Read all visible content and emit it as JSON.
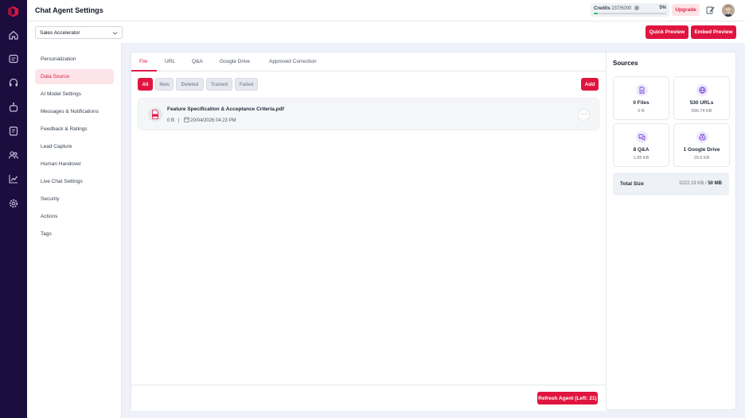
{
  "header": {
    "title": "Chat Agent Settings",
    "credits_label": "Credits",
    "credits_value": "237/5000",
    "credits_percent": "5%",
    "credits_fraction": 0.05,
    "upgrade_label": "Upgrade"
  },
  "toolbar": {
    "agent_select_value": "Sales Accelerator",
    "quick_preview_label": "Quick Preview",
    "embed_preview_label": "Embed Preview"
  },
  "nav": {
    "items": [
      {
        "label": "Personalization"
      },
      {
        "label": "Data Source"
      },
      {
        "label": "AI Model Settings"
      },
      {
        "label": "Messages & Notifications"
      },
      {
        "label": "Feedback & Ratings"
      },
      {
        "label": "Lead Capture"
      },
      {
        "label": "Human Handover"
      },
      {
        "label": "Live Chat Settings"
      },
      {
        "label": "Security"
      },
      {
        "label": "Actions"
      },
      {
        "label": "Tags"
      }
    ],
    "active_index": 1
  },
  "tabs": [
    {
      "label": "File"
    },
    {
      "label": "URL"
    },
    {
      "label": "Q&A"
    },
    {
      "label": "Google Drive"
    },
    {
      "label": "Approved Correction"
    }
  ],
  "filters": [
    {
      "label": "All"
    },
    {
      "label": "New"
    },
    {
      "label": "Deleted"
    },
    {
      "label": "Trained"
    },
    {
      "label": "Failed"
    }
  ],
  "add_label": "Add",
  "files": [
    {
      "name": "Feature Specification & Acceptance Criteria.pdf",
      "size": "0 B",
      "separator": "|",
      "date": "20/04/2026 04:23 PM"
    }
  ],
  "refresh_label": "Refresh Agent (Left: 21)",
  "sources": {
    "title": "Sources",
    "cards": [
      {
        "title": "0 Files",
        "size": "0 B",
        "icon": "file-icon"
      },
      {
        "title": "530 URLs",
        "size": "990.74 KB",
        "icon": "globe-icon"
      },
      {
        "title": "8 Q&A",
        "size": "1.85 KB",
        "icon": "chat-bubbles-icon"
      },
      {
        "title": "1 Google Drive",
        "size": "29.6 KB",
        "icon": "google-drive-icon"
      }
    ],
    "total_label": "Total Size",
    "total_used": "1022.19 KB",
    "total_sep": " / ",
    "total_limit": "50 MB"
  },
  "colors": {
    "accent": "#e0153f",
    "rail": "#1c0d3f",
    "progress": "#22c55e",
    "icon_purple": "#6d28d9"
  }
}
